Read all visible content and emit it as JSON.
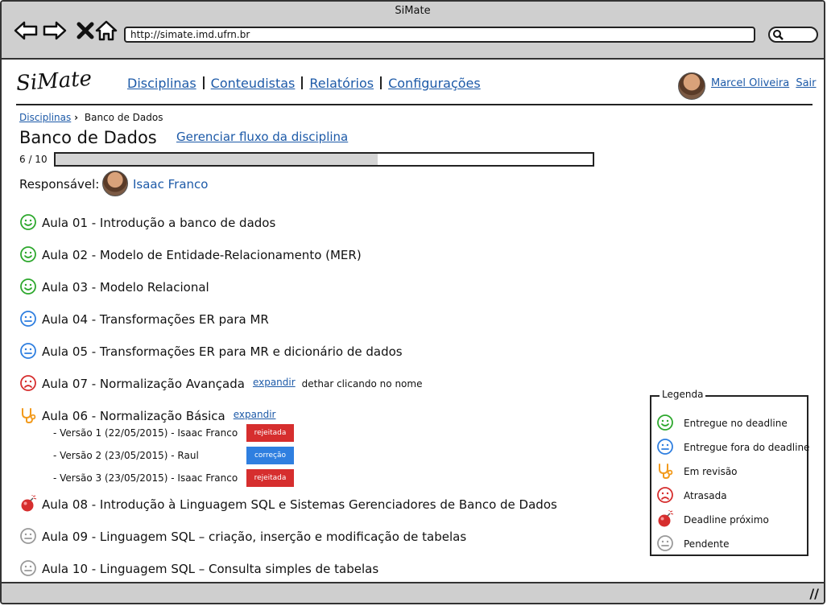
{
  "window": {
    "title": "SiMate",
    "url": "http://simate.imd.ufrn.br"
  },
  "app": {
    "logo": "SiMate"
  },
  "nav": {
    "items": [
      "Disciplinas",
      "Conteudistas",
      "Relatórios",
      "Configurações"
    ]
  },
  "user": {
    "name": "Marcel Oliveira",
    "logout": "Sair"
  },
  "breadcrumb": {
    "parent": "Disciplinas",
    "current": "Banco de Dados"
  },
  "page": {
    "title": "Banco de Dados",
    "manage_link": "Gerenciar fluxo da disciplina"
  },
  "progress": {
    "label": "6 / 10",
    "fraction": 0.6
  },
  "responsible": {
    "label": "Responsável:",
    "name": "Isaac Franco"
  },
  "lessons": [
    {
      "icon": "smile-green-icon",
      "title": "Aula 01 - Introdução a banco de dados"
    },
    {
      "icon": "smile-green-icon",
      "title": "Aula 02 - Modelo de Entidade-Relacionamento (MER)"
    },
    {
      "icon": "smile-green-icon",
      "title": "Aula 03 - Modelo Relacional"
    },
    {
      "icon": "neutral-blue-icon",
      "title": "Aula 04 - Transformações ER para MR"
    },
    {
      "icon": "neutral-blue-icon",
      "title": "Aula 05 - Transformações ER para MR e dicionário de dados"
    },
    {
      "icon": "sad-red-icon",
      "title": "Aula 07 - Normalização Avançada",
      "expand": "expandir",
      "hint": "dethar clicando no nome"
    },
    {
      "icon": "stethoscope-icon",
      "title": "Aula 06 - Normalização Básica",
      "expand": "expandir"
    },
    {
      "icon": "bomb-icon",
      "title": "Aula 08 - Introdução à Linguagem SQL e Sistemas Gerenciadores de Banco de Dados"
    },
    {
      "icon": "neutral-gray-icon",
      "title": "Aula 09 - Linguagem SQL – criação, inserção e modificação de tabelas"
    },
    {
      "icon": "neutral-gray-icon",
      "title": "Aula 10 - Linguagem SQL – Consulta simples de tabelas"
    }
  ],
  "versions": [
    {
      "text": "- Versão 1 (22/05/2015) - Isaac Franco",
      "badge": "rejeitada",
      "color": "#d62e2e"
    },
    {
      "text": "- Versão 2 (23/05/2015) - Raul",
      "badge": "correção",
      "color": "#2f7fe0"
    },
    {
      "text": "- Versão 3 (23/05/2015) - Isaac Franco",
      "badge": "rejeitada",
      "color": "#d62e2e"
    }
  ],
  "legend": {
    "title": "Legenda",
    "items": [
      {
        "icon": "smile-green-icon",
        "label": "Entregue no deadline"
      },
      {
        "icon": "neutral-blue-icon",
        "label": "Entregue fora do deadline"
      },
      {
        "icon": "stethoscope-icon",
        "label": "Em revisão"
      },
      {
        "icon": "sad-red-icon",
        "label": "Atrasada"
      },
      {
        "icon": "bomb-icon",
        "label": "Deadline próximo"
      },
      {
        "icon": "neutral-gray-icon",
        "label": "Pendente"
      }
    ]
  },
  "colors": {
    "green": "#2ea82e",
    "blue": "#2f7fe0",
    "red": "#d62e2e",
    "orange": "#f29a1c",
    "gray": "#9a9a9a",
    "link": "#1d5aa8"
  }
}
